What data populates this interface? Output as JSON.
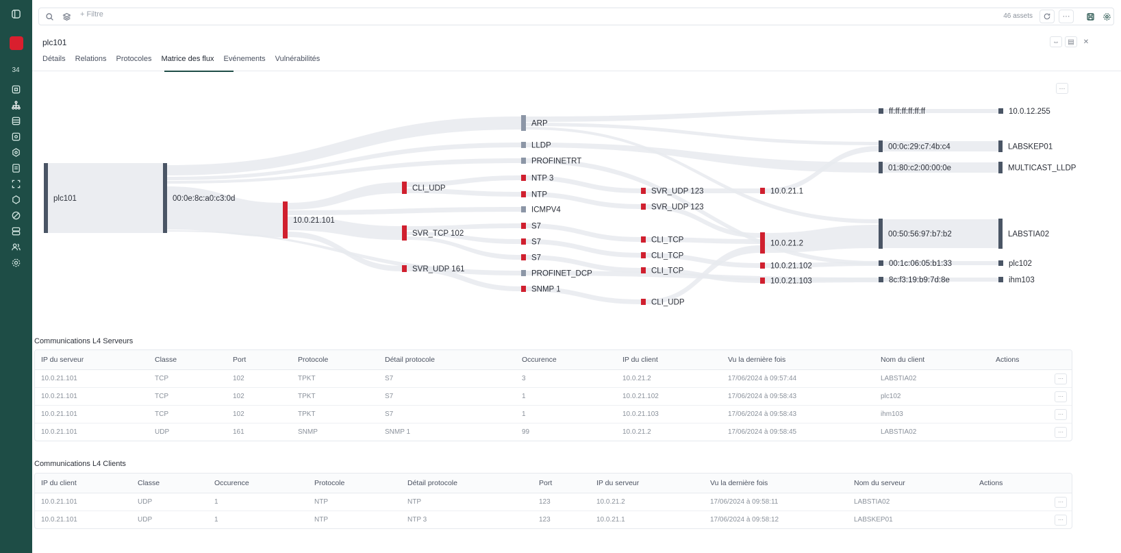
{
  "rail": {
    "count": "34",
    "icons": [
      "sidebar-toggle-icon",
      "alert-icon",
      "dashboard-icon",
      "network-icon",
      "database-icon",
      "box-icon",
      "puzzle-icon",
      "report-icon",
      "scan-icon",
      "shield-icon",
      "tag-icon",
      "server-icon",
      "users-icon",
      "settings-icon"
    ]
  },
  "topbar": {
    "filter_label": "+ Filtre",
    "assets_count": "46 assets"
  },
  "page": {
    "title": "plc101"
  },
  "tabs": [
    {
      "label": "Détails"
    },
    {
      "label": "Relations"
    },
    {
      "label": "Protocoles"
    },
    {
      "label": "Matrice des flux",
      "active": true
    },
    {
      "label": "Evénements"
    },
    {
      "label": "Vulnérabilités"
    }
  ],
  "sankey": {
    "nodes": {
      "n_plc": "plc101",
      "n_mac": "00:0e:8c:a0:c3:0d",
      "n_ip": "10.0.21.101",
      "n_cliudp": "CLI_UDP",
      "n_svrtcp": "SVR_TCP 102",
      "n_svrudp161": "SVR_UDP 161",
      "n_arp": "ARP",
      "n_lldp": "LLDP",
      "n_profinetrt": "PROFINETRT",
      "n_ntp3": "NTP 3",
      "n_ntp": "NTP",
      "n_icmp": "ICMPV4",
      "n_s7a": "S7",
      "n_s7b": "S7",
      "n_s7c": "S7",
      "n_pndcp": "PROFINET_DCP",
      "n_snmp": "SNMP 1",
      "n_svrudp123a": "SVR_UDP 123",
      "n_svrudp123b": "SVR_UDP 123",
      "n_clitcp1": "CLI_TCP",
      "n_clitcp2": "CLI_TCP",
      "n_clitcp3": "CLI_TCP",
      "n_cliudp2": "CLI_UDP",
      "n_ip211": "10.0.21.1",
      "n_ip212": "10.0.21.2",
      "n_ip21102": "10.0.21.102",
      "n_ip21103": "10.0.21.103",
      "n_macbc": "ff:ff:ff:ff:ff:ff",
      "n_mac29": "00:0c:29:c7:4b:c4",
      "n_mac0180": "01:80:c2:00:00:0e",
      "n_mac50": "00:50:56:97:b7:b2",
      "n_mac1c": "00:1c:06:05:b1:33",
      "n_mac8c": "8c:f3:19:b9:7d:8e",
      "n_ipbc": "10.0.12.255",
      "n_labskep": "LABSKEP01",
      "n_multicast": "MULTICAST_LLDP",
      "n_labstia": "LABSTIA02",
      "n_plc102": "plc102",
      "n_ihm103": "ihm103"
    },
    "colors": {
      "flow": "#e8eaee",
      "node": "#4a5565",
      "red": "#d0202f",
      "grey": "#8c96a6"
    }
  },
  "servers": {
    "title": "Communications L4 Serveurs",
    "columns": [
      "IP du serveur",
      "Classe",
      "Port",
      "Protocole",
      "Détail protocole",
      "Occurence",
      "IP du client",
      "Vu la dernière fois",
      "Nom du client",
      "Actions"
    ],
    "rows": [
      [
        "10.0.21.101",
        "TCP",
        "102",
        "TPKT",
        "S7",
        "3",
        "10.0.21.2",
        "17/06/2024 à 09:57:44",
        "LABSTIA02"
      ],
      [
        "10.0.21.101",
        "TCP",
        "102",
        "TPKT",
        "S7",
        "1",
        "10.0.21.102",
        "17/06/2024 à 09:58:43",
        "plc102"
      ],
      [
        "10.0.21.101",
        "TCP",
        "102",
        "TPKT",
        "S7",
        "1",
        "10.0.21.103",
        "17/06/2024 à 09:58:43",
        "ihm103"
      ],
      [
        "10.0.21.101",
        "UDP",
        "161",
        "SNMP",
        "SNMP 1",
        "99",
        "10.0.21.2",
        "17/06/2024 à 09:58:45",
        "LABSTIA02"
      ]
    ]
  },
  "clients": {
    "title": "Communications L4 Clients",
    "columns": [
      "IP du client",
      "Classe",
      "Occurence",
      "Protocole",
      "Détail protocole",
      "Port",
      "IP du serveur",
      "Vu la dernière fois",
      "Nom du serveur",
      "Actions"
    ],
    "rows": [
      [
        "10.0.21.101",
        "UDP",
        "1",
        "NTP",
        "NTP",
        "123",
        "10.0.21.2",
        "17/06/2024 à 09:58:11",
        "LABSTIA02"
      ],
      [
        "10.0.21.101",
        "UDP",
        "1",
        "NTP",
        "NTP 3",
        "123",
        "10.0.21.1",
        "17/06/2024 à 09:58:12",
        "LABSKEP01"
      ]
    ]
  }
}
